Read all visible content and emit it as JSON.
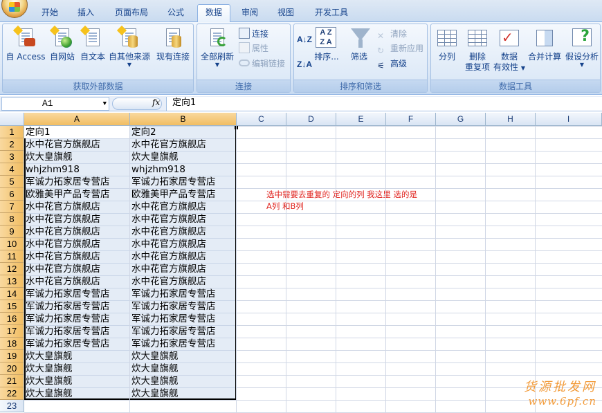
{
  "tabs": [
    {
      "label": "开始",
      "active": false
    },
    {
      "label": "插入",
      "active": false
    },
    {
      "label": "页面布局",
      "active": false
    },
    {
      "label": "公式",
      "active": false
    },
    {
      "label": "数据",
      "active": true
    },
    {
      "label": "审阅",
      "active": false
    },
    {
      "label": "视图",
      "active": false
    },
    {
      "label": "开发工具",
      "active": false
    }
  ],
  "ribbon": {
    "groups": {
      "external": "获取外部数据",
      "connections": "连接",
      "sort_filter": "排序和筛选",
      "data_tools": "数据工具"
    },
    "external_buttons": {
      "access": "自 Access",
      "web": "自网站",
      "text": "自文本",
      "other": "自其他来源",
      "existing": "现有连接"
    },
    "connections": {
      "refresh_all": "全部刷新",
      "connections": "连接",
      "properties": "属性",
      "edit_links": "编辑链接"
    },
    "sort_filter": {
      "sort": "排序...",
      "filter": "筛选",
      "clear": "清除",
      "reapply": "重新应用",
      "advanced": "高级"
    },
    "data_tools": {
      "text_to_columns": "分列",
      "remove_duplicates_1": "删除",
      "remove_duplicates_2": "重复项",
      "validation_1": "数据",
      "validation_2": "有效性",
      "consolidate": "合并计算",
      "what_if": "假设分析"
    }
  },
  "formula_bar": {
    "name_box": "A1",
    "fx": "fx",
    "value": "定向1"
  },
  "columns": [
    "A",
    "B",
    "C",
    "D",
    "E",
    "F",
    "G",
    "H",
    "I"
  ],
  "rows": [
    "1",
    "2",
    "3",
    "4",
    "5",
    "6",
    "7",
    "8",
    "9",
    "10",
    "11",
    "12",
    "13",
    "14",
    "15",
    "16",
    "17",
    "18",
    "19",
    "20",
    "21",
    "22",
    "23"
  ],
  "cells": [
    [
      "定向1",
      "定向2"
    ],
    [
      "水中花官方旗舰店",
      "水中花官方旗舰店"
    ],
    [
      "炊大皇旗舰",
      "炊大皇旗舰"
    ],
    [
      "whjzhm918",
      "whjzhm918"
    ],
    [
      "军诚力拓家居专营店",
      "军诚力拓家居专营店"
    ],
    [
      "欧雅美甲产品专营店",
      "欧雅美甲产品专营店"
    ],
    [
      "水中花官方旗舰店",
      "水中花官方旗舰店"
    ],
    [
      "水中花官方旗舰店",
      "水中花官方旗舰店"
    ],
    [
      "水中花官方旗舰店",
      "水中花官方旗舰店"
    ],
    [
      "水中花官方旗舰店",
      "水中花官方旗舰店"
    ],
    [
      "水中花官方旗舰店",
      "水中花官方旗舰店"
    ],
    [
      "水中花官方旗舰店",
      "水中花官方旗舰店"
    ],
    [
      "水中花官方旗舰店",
      "水中花官方旗舰店"
    ],
    [
      "军诚力拓家居专营店",
      "军诚力拓家居专营店"
    ],
    [
      "军诚力拓家居专营店",
      "军诚力拓家居专营店"
    ],
    [
      "军诚力拓家居专营店",
      "军诚力拓家居专营店"
    ],
    [
      "军诚力拓家居专营店",
      "军诚力拓家居专营店"
    ],
    [
      "军诚力拓家居专营店",
      "军诚力拓家居专营店"
    ],
    [
      "炊大皇旗舰",
      "炊大皇旗舰"
    ],
    [
      "炊大皇旗舰",
      "炊大皇旗舰"
    ],
    [
      "炊大皇旗舰",
      "炊大皇旗舰"
    ],
    [
      "炊大皇旗舰",
      "炊大皇旗舰"
    ]
  ],
  "note": "选中需要去重复的  定向的列   我这里 选的是 A列 和B列",
  "watermark": {
    "line1": "货源批发网",
    "line2": "www.6pf.cn"
  }
}
